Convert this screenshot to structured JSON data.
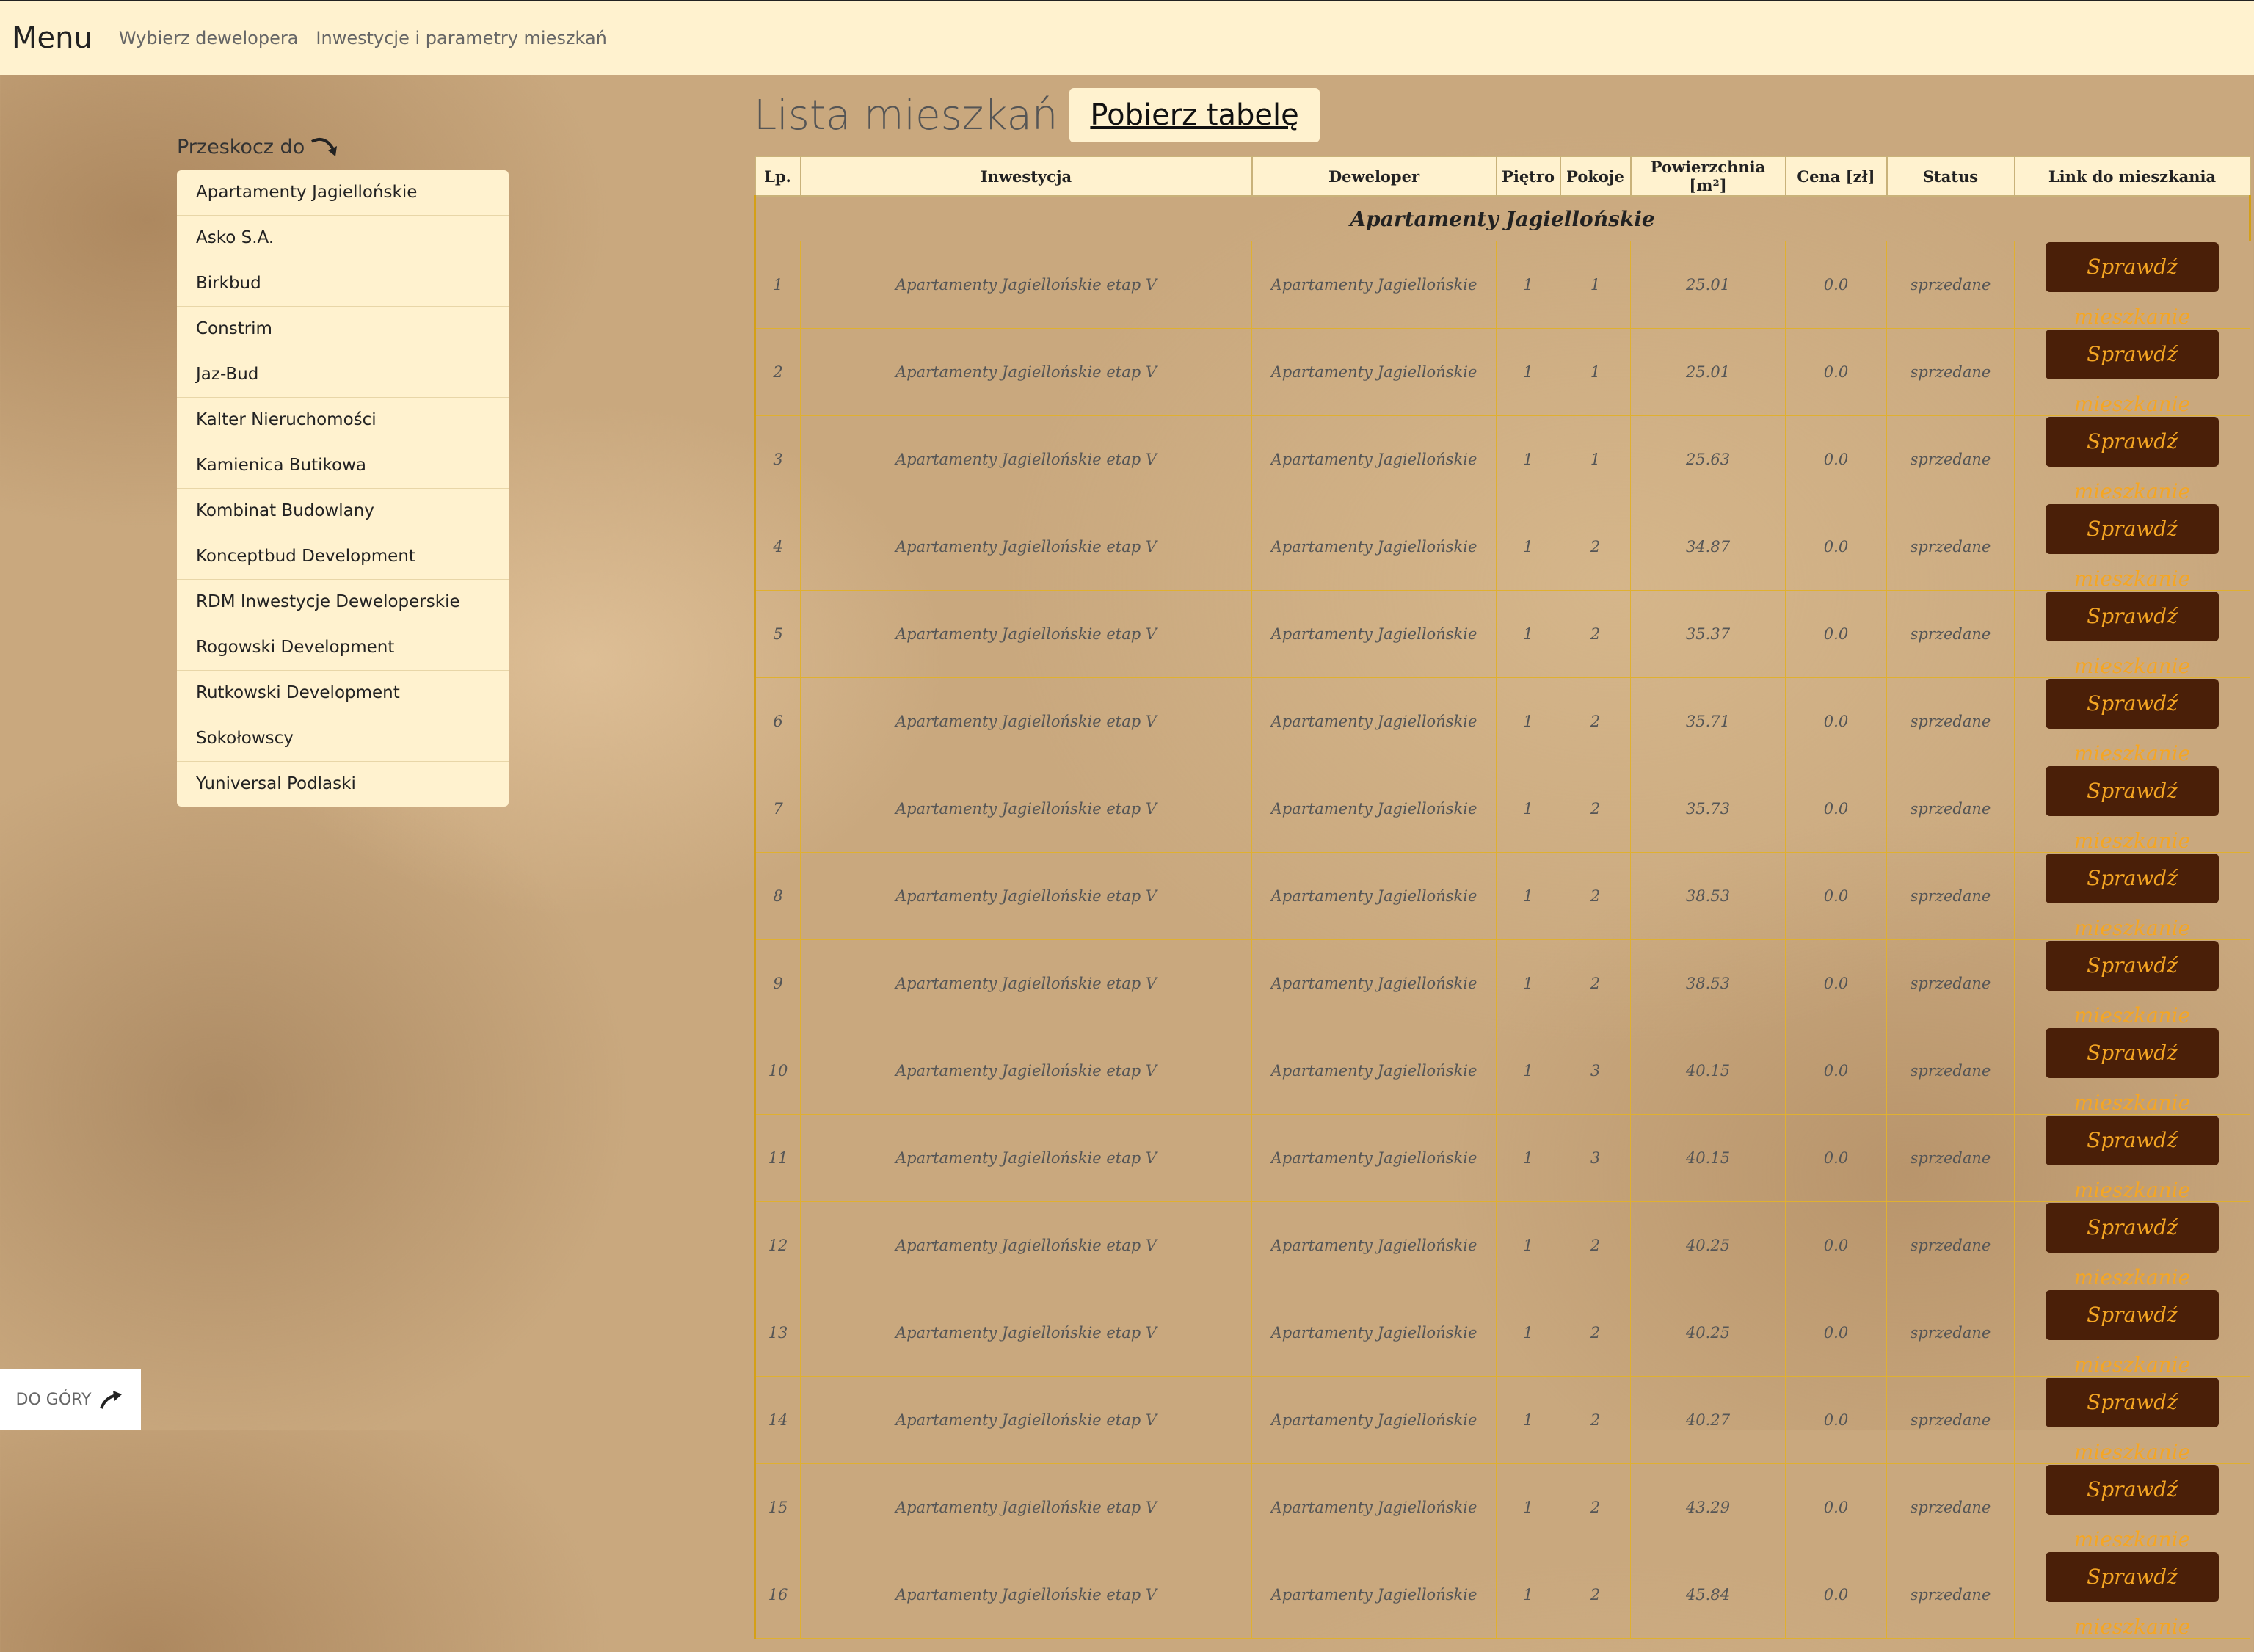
{
  "nav": {
    "brand": "Menu",
    "links": [
      "Wybierz dewelopera",
      "Inwestycje i parametry mieszkań"
    ]
  },
  "sidebar": {
    "jump_label": "Przeskocz do",
    "items": [
      "Apartamenty Jagiellońskie",
      "Asko S.A.",
      "Birkbud",
      "Constrim",
      "Jaz-Bud",
      "Kalter Nieruchomości",
      "Kamienica Butikowa",
      "Kombinat Budowlany",
      "Konceptbud Development",
      "RDM Inwestycje Deweloperskie",
      "Rogowski Development",
      "Rutkowski Development",
      "Sokołowscy",
      "Yuniversal Podlaski"
    ]
  },
  "main": {
    "title": "Lista mieszkań",
    "download_label": "Pobierz tabelę",
    "table": {
      "headers": [
        "Lp.",
        "Inwestycja",
        "Deweloper",
        "Piętro",
        "Pokoje",
        "Powierzchnia [m²]",
        "Cena [zł]",
        "Status",
        "Link do mieszkania"
      ],
      "group": "Apartamenty Jagiellońskie",
      "button_label": "Sprawdź mieszkanie",
      "rows": [
        {
          "lp": "1",
          "inv": "Apartamenty Jagiellońskie etap V",
          "dev": "Apartamenty Jagiellońskie",
          "floor": "1",
          "rooms": "1",
          "area": "25.01",
          "price": "0.0",
          "status": "sprzedane"
        },
        {
          "lp": "2",
          "inv": "Apartamenty Jagiellońskie etap V",
          "dev": "Apartamenty Jagiellońskie",
          "floor": "1",
          "rooms": "1",
          "area": "25.01",
          "price": "0.0",
          "status": "sprzedane"
        },
        {
          "lp": "3",
          "inv": "Apartamenty Jagiellońskie etap V",
          "dev": "Apartamenty Jagiellońskie",
          "floor": "1",
          "rooms": "1",
          "area": "25.63",
          "price": "0.0",
          "status": "sprzedane"
        },
        {
          "lp": "4",
          "inv": "Apartamenty Jagiellońskie etap V",
          "dev": "Apartamenty Jagiellońskie",
          "floor": "1",
          "rooms": "2",
          "area": "34.87",
          "price": "0.0",
          "status": "sprzedane"
        },
        {
          "lp": "5",
          "inv": "Apartamenty Jagiellońskie etap V",
          "dev": "Apartamenty Jagiellońskie",
          "floor": "1",
          "rooms": "2",
          "area": "35.37",
          "price": "0.0",
          "status": "sprzedane"
        },
        {
          "lp": "6",
          "inv": "Apartamenty Jagiellońskie etap V",
          "dev": "Apartamenty Jagiellońskie",
          "floor": "1",
          "rooms": "2",
          "area": "35.71",
          "price": "0.0",
          "status": "sprzedane"
        },
        {
          "lp": "7",
          "inv": "Apartamenty Jagiellońskie etap V",
          "dev": "Apartamenty Jagiellońskie",
          "floor": "1",
          "rooms": "2",
          "area": "35.73",
          "price": "0.0",
          "status": "sprzedane"
        },
        {
          "lp": "8",
          "inv": "Apartamenty Jagiellońskie etap V",
          "dev": "Apartamenty Jagiellońskie",
          "floor": "1",
          "rooms": "2",
          "area": "38.53",
          "price": "0.0",
          "status": "sprzedane"
        },
        {
          "lp": "9",
          "inv": "Apartamenty Jagiellońskie etap V",
          "dev": "Apartamenty Jagiellońskie",
          "floor": "1",
          "rooms": "2",
          "area": "38.53",
          "price": "0.0",
          "status": "sprzedane"
        },
        {
          "lp": "10",
          "inv": "Apartamenty Jagiellońskie etap V",
          "dev": "Apartamenty Jagiellońskie",
          "floor": "1",
          "rooms": "3",
          "area": "40.15",
          "price": "0.0",
          "status": "sprzedane"
        },
        {
          "lp": "11",
          "inv": "Apartamenty Jagiellońskie etap V",
          "dev": "Apartamenty Jagiellońskie",
          "floor": "1",
          "rooms": "3",
          "area": "40.15",
          "price": "0.0",
          "status": "sprzedane"
        },
        {
          "lp": "12",
          "inv": "Apartamenty Jagiellońskie etap V",
          "dev": "Apartamenty Jagiellońskie",
          "floor": "1",
          "rooms": "2",
          "area": "40.25",
          "price": "0.0",
          "status": "sprzedane"
        },
        {
          "lp": "13",
          "inv": "Apartamenty Jagiellońskie etap V",
          "dev": "Apartamenty Jagiellońskie",
          "floor": "1",
          "rooms": "2",
          "area": "40.25",
          "price": "0.0",
          "status": "sprzedane"
        },
        {
          "lp": "14",
          "inv": "Apartamenty Jagiellońskie etap V",
          "dev": "Apartamenty Jagiellońskie",
          "floor": "1",
          "rooms": "2",
          "area": "40.27",
          "price": "0.0",
          "status": "sprzedane"
        },
        {
          "lp": "15",
          "inv": "Apartamenty Jagiellońskie etap V",
          "dev": "Apartamenty Jagiellońskie",
          "floor": "1",
          "rooms": "2",
          "area": "43.29",
          "price": "0.0",
          "status": "sprzedane"
        },
        {
          "lp": "16",
          "inv": "Apartamenty Jagiellońskie etap V",
          "dev": "Apartamenty Jagiellońskie",
          "floor": "1",
          "rooms": "2",
          "area": "45.84",
          "price": "0.0",
          "status": "sprzedane"
        }
      ]
    }
  },
  "to_top_label": "DO GÓRY",
  "icons": {
    "jump": "curved-arrow-down-icon",
    "to_top": "curved-arrow-up-icon"
  },
  "colors": {
    "bar_bg": "#fff2cf",
    "button_bg": "#4a1f08",
    "button_text": "#f5a623",
    "table_border": "#d4a017"
  }
}
